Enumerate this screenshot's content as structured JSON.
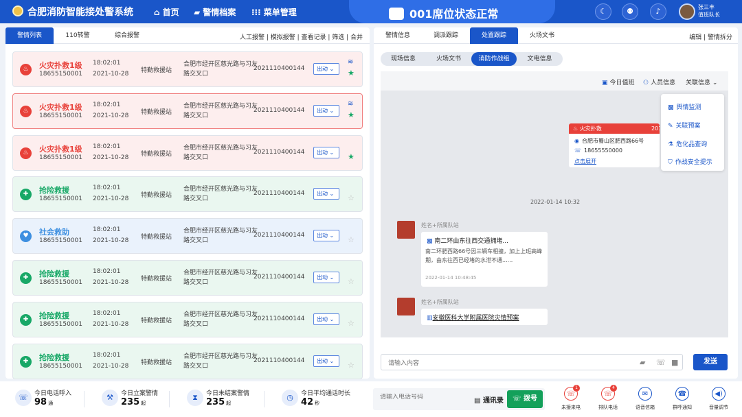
{
  "header": {
    "app_title": "合肥消防智能接处警系统",
    "nav": [
      {
        "label": "首页",
        "icon": "home-icon"
      },
      {
        "label": "警情档案",
        "icon": "folder-icon"
      },
      {
        "label": "菜单管理",
        "icon": "grid-icon"
      }
    ],
    "seat_status": "001席位状态正常",
    "user_name": "张三丰",
    "user_role": "值班队长",
    "icons": [
      "moon-icon",
      "user-icon",
      "bell-icon"
    ]
  },
  "left_panel": {
    "tabs": [
      "警情列表",
      "110转警",
      "综合报警"
    ],
    "actions": "人工报警 | 模拟报警 | 查看记录 | 筛选 | 合并",
    "dispatch_label": "出动",
    "incidents": [
      {
        "type": "火灾扑救1级",
        "phone": "18655150001",
        "time": "18:02:01",
        "date": "2021-10-28",
        "station": "特勤救援站",
        "address": "合肥市经开区慈光路与习友路交叉口",
        "number": "2021110400144",
        "color": "#e8413a",
        "bg": "#fdeeee",
        "icon": "fire-icon",
        "stack": true,
        "star": "filled"
      },
      {
        "type": "火灾扑救1级",
        "phone": "18655150001",
        "time": "18:02:01",
        "date": "2021-10-28",
        "station": "特勤救援站",
        "address": "合肥市经开区慈光路与习友路交叉口",
        "number": "2021110400144",
        "color": "#e8413a",
        "bg": "#fdeeee",
        "icon": "fire-icon",
        "stack": true,
        "star": "filled"
      },
      {
        "type": "火灾扑救1级",
        "phone": "18655150001",
        "time": "18:02:01",
        "date": "2021-10-28",
        "station": "特勤救援站",
        "address": "合肥市经开区慈光路与习友路交叉口",
        "number": "2021110400144",
        "color": "#e8413a",
        "bg": "#fdeeee",
        "icon": "fire-icon",
        "stack": false,
        "star": "filled"
      },
      {
        "type": "抢险救援",
        "phone": "18655150001",
        "time": "18:02:01",
        "date": "2021-10-28",
        "station": "特勤救援站",
        "address": "合肥市经开区慈光路与习友路交叉口",
        "number": "2021110400144",
        "color": "#18a867",
        "bg": "#eaf7f0",
        "icon": "rescue-icon",
        "stack": false,
        "star": "empty"
      },
      {
        "type": "社会救助",
        "phone": "18655150001",
        "time": "18:02:01",
        "date": "2021-10-28",
        "station": "特勤救援站",
        "address": "合肥市经开区慈光路与习友路交叉口",
        "number": "2021110400144",
        "color": "#3d8fe0",
        "bg": "#eaf2fc",
        "icon": "aid-icon",
        "stack": false,
        "star": "empty"
      },
      {
        "type": "抢险救援",
        "phone": "18655150001",
        "time": "18:02:01",
        "date": "2021-10-28",
        "station": "特勤救援站",
        "address": "合肥市经开区慈光路与习友路交叉口",
        "number": "2021110400144",
        "color": "#18a867",
        "bg": "#eaf7f0",
        "icon": "rescue-icon",
        "stack": false,
        "star": "empty"
      },
      {
        "type": "抢险救援",
        "phone": "18655150001",
        "time": "18:02:01",
        "date": "2021-10-28",
        "station": "特勤救援站",
        "address": "合肥市经开区慈光路与习友路交叉口",
        "number": "2021110400144",
        "color": "#18a867",
        "bg": "#eaf7f0",
        "icon": "rescue-icon",
        "stack": false,
        "star": "empty"
      },
      {
        "type": "抢险救援",
        "phone": "18655150001",
        "time": "18:02:01",
        "date": "2021-10-28",
        "station": "特勤救援站",
        "address": "合肥市经开区慈光路与习友路交叉口",
        "number": "2021110400144",
        "color": "#18a867",
        "bg": "#eaf7f0",
        "icon": "rescue-icon",
        "stack": false,
        "star": "empty"
      }
    ]
  },
  "right_panel": {
    "tabs": [
      "警情信息",
      "调派跟踪",
      "处置跟踪",
      "火场文书"
    ],
    "actions": "编辑 | 警情拆分",
    "sub_tabs": [
      "现场信息",
      "火场文书",
      "消防作战组",
      "文电信息"
    ],
    "chat_toolbar": {
      "duty": "今日值班",
      "staff": "人员信息",
      "related": "关联信息"
    },
    "related_menu": [
      "舆情监测",
      "关联预案",
      "危化品查询",
      "作战安全提示"
    ],
    "fire_card": {
      "title": "火灾扑救",
      "code": "201",
      "address": "合肥市蜀山区肥西路66号",
      "phone": "18655550000",
      "expand": "点击展开"
    },
    "timestamp": "2022-01-14 10:32",
    "messages": [
      {
        "sender": "姓名+所属队站",
        "title": "南二环由东往西交通拥堵...",
        "body": "南二环肥西路66号因三辆车相撞，加上上班高峰期，由东往西已经堵的水泄不通......",
        "time": "2022-01-14 10:48:45"
      },
      {
        "sender": "姓名+所属队站",
        "link": "安徽医科大学附属医院灾情预案"
      }
    ],
    "input_placeholder": "请输入内容",
    "send": "发送"
  },
  "bottom": {
    "stats": [
      {
        "label": "今日电话呼入",
        "value": "98",
        "unit": "通",
        "icon": "phone-in-icon"
      },
      {
        "label": "今日立案警情",
        "value": "235",
        "unit": "起",
        "icon": "gavel-icon"
      },
      {
        "label": "今日未结案警情",
        "value": "235",
        "unit": "起",
        "icon": "hourglass-icon"
      },
      {
        "label": "今日平均通话时长",
        "value": "42",
        "unit": "秒",
        "icon": "stopwatch-icon"
      }
    ],
    "dial_placeholder": "请输入电话号码",
    "contacts": "通讯录",
    "call": "拨号",
    "quick": [
      {
        "label": "未接来电",
        "badge": "1",
        "color": "#e8413a",
        "icon": "missed-call-icon"
      },
      {
        "label": "排队电话",
        "badge": "4",
        "color": "#e8413a",
        "icon": "queue-call-icon"
      },
      {
        "label": "语音信箱",
        "color": "#1a56c9",
        "icon": "mail-icon"
      },
      {
        "label": "群呼通知",
        "color": "#1a56c9",
        "icon": "group-call-icon"
      },
      {
        "label": "音量调节",
        "color": "#1a56c9",
        "icon": "volume-icon"
      }
    ]
  }
}
